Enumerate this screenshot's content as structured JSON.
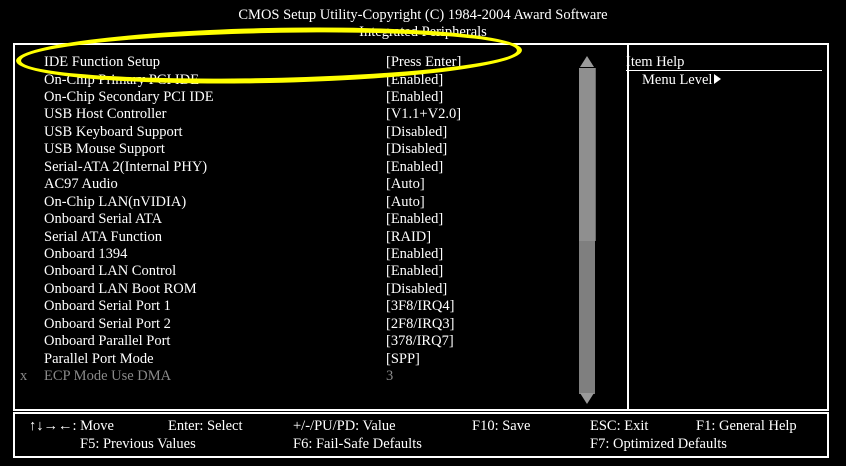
{
  "title": {
    "line1": "CMOS Setup Utility-Copyright (C) 1984-2004 Award Software",
    "line2": "Integrated Peripherals"
  },
  "items": [
    {
      "label": "IDE Function Setup",
      "value": "[Press Enter]",
      "disabled": false,
      "mark": ""
    },
    {
      "label": "On-Chip Primary PCI IDE",
      "value": "[Enabled]",
      "disabled": false,
      "mark": ""
    },
    {
      "label": "On-Chip Secondary PCI IDE",
      "value": "[Enabled]",
      "disabled": false,
      "mark": ""
    },
    {
      "label": "USB Host Controller",
      "value": "[V1.1+V2.0]",
      "disabled": false,
      "mark": ""
    },
    {
      "label": "USB Keyboard Support",
      "value": "[Disabled]",
      "disabled": false,
      "mark": ""
    },
    {
      "label": "USB Mouse Support",
      "value": "[Disabled]",
      "disabled": false,
      "mark": ""
    },
    {
      "label": "Serial-ATA 2(Internal PHY)",
      "value": "[Enabled]",
      "disabled": false,
      "mark": ""
    },
    {
      "label": "AC97 Audio",
      "value": "[Auto]",
      "disabled": false,
      "mark": ""
    },
    {
      "label": "On-Chip LAN(nVIDIA)",
      "value": "[Auto]",
      "disabled": false,
      "mark": ""
    },
    {
      "label": "Onboard Serial ATA",
      "value": "[Enabled]",
      "disabled": false,
      "mark": ""
    },
    {
      "label": "Serial ATA Function",
      "value": "[RAID]",
      "disabled": false,
      "mark": ""
    },
    {
      "label": "Onboard 1394",
      "value": "[Enabled]",
      "disabled": false,
      "mark": ""
    },
    {
      "label": "Onboard LAN Control",
      "value": "[Enabled]",
      "disabled": false,
      "mark": ""
    },
    {
      "label": "Onboard LAN Boot ROM",
      "value": "[Disabled]",
      "disabled": false,
      "mark": ""
    },
    {
      "label": "Onboard Serial Port 1",
      "value": "[3F8/IRQ4]",
      "disabled": false,
      "mark": ""
    },
    {
      "label": "Onboard Serial Port 2",
      "value": "[2F8/IRQ3]",
      "disabled": false,
      "mark": ""
    },
    {
      "label": "Onboard Parallel Port",
      "value": "[378/IRQ7]",
      "disabled": false,
      "mark": ""
    },
    {
      "label": "Parallel Port Mode",
      "value": "[SPP]",
      "disabled": false,
      "mark": ""
    },
    {
      "label": "ECP Mode Use DMA",
      "value": "3",
      "disabled": true,
      "mark": "x"
    }
  ],
  "help": {
    "title": "Item Help",
    "menu_level": "Menu Level"
  },
  "footer": {
    "move_arrows": "↑↓→←",
    "move": ": Move",
    "enter": "Enter: Select",
    "value": "+/-/PU/PD: Value",
    "save": "F10: Save",
    "exit": "ESC: Exit",
    "general_help": "F1: General Help",
    "previous": "F5: Previous Values",
    "failsafe": "F6: Fail-Safe Defaults",
    "optimized": "F7: Optimized Defaults"
  },
  "colors": {
    "background": "#000000",
    "text": "#ffffff",
    "disabled": "#8a8a8a",
    "highlight_ellipse": "#ffff00"
  }
}
